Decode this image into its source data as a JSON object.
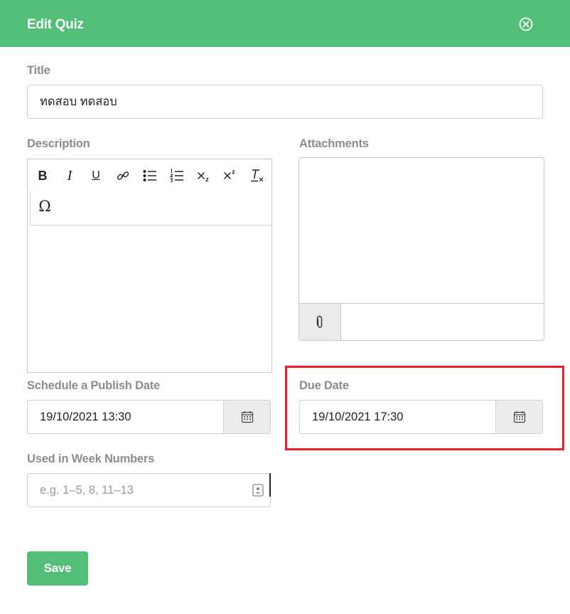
{
  "header": {
    "title": "Edit Quiz",
    "close_icon": "close-circle-icon"
  },
  "form": {
    "title_label": "Title",
    "title_value": "ทดสอบ ทดสอบ",
    "description_label": "Description",
    "attachments_label": "Attachments",
    "publish_date_label": "Schedule a Publish Date",
    "publish_date_value": "19/10/2021 13:30",
    "due_date_label": "Due Date",
    "due_date_value": "19/10/2021 17:30",
    "week_numbers_label": "Used in Week Numbers",
    "week_numbers_placeholder": "e.g. 1–5, 8, 11–13",
    "save_label": "Save"
  },
  "editor_toolbar": {
    "buttons": [
      "bold-icon",
      "italic-icon",
      "underline-icon",
      "link-icon",
      "bulleted-list-icon",
      "numbered-list-icon",
      "subscript-icon",
      "superscript-icon",
      "clear-formatting-icon",
      "special-character-icon"
    ],
    "bold_glyph": "B",
    "italic_glyph": "I",
    "underline_glyph": "U",
    "omega_glyph": "Ω"
  },
  "colors": {
    "accent": "#52be78",
    "highlight": "#e3212b",
    "label": "#8c8c8c"
  }
}
